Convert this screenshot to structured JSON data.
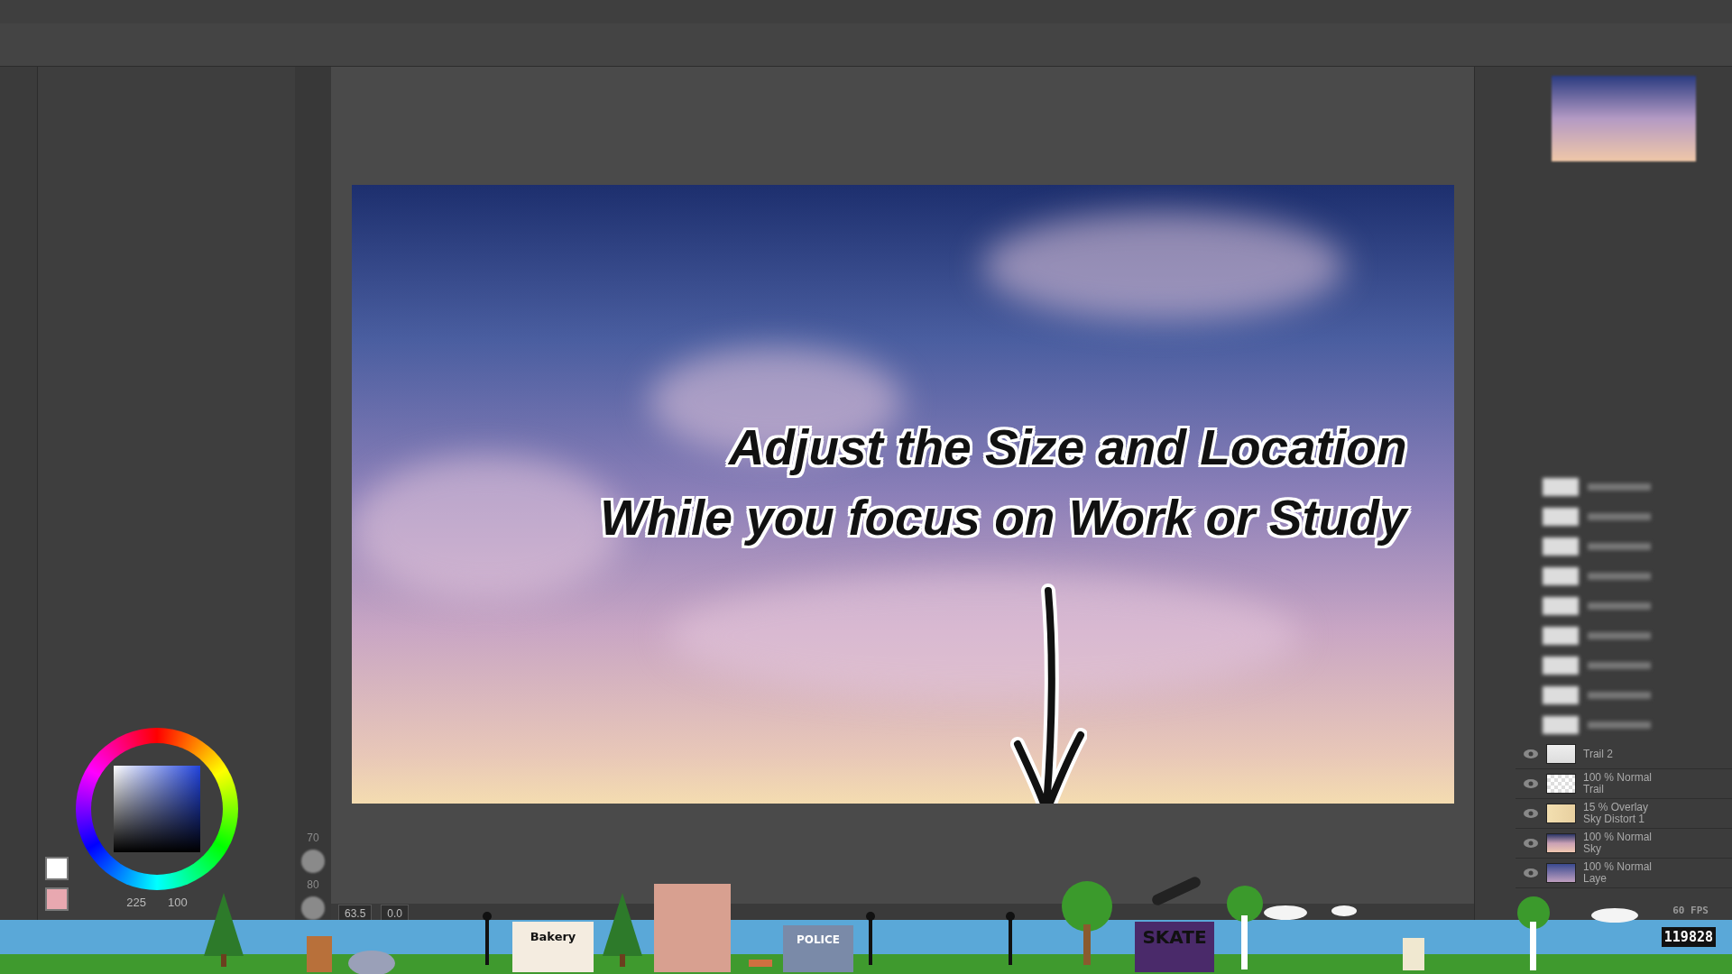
{
  "headline": [
    "Adjust the Size and Location",
    "While you focus on Work or Study"
  ],
  "color_panel": {
    "hue": "225",
    "value": "100"
  },
  "brush_sizes": [
    "70",
    "80"
  ],
  "canvas_nav": {
    "zoom": "63.5",
    "angle": "0.0"
  },
  "layers": [
    {
      "name": "Trail 2"
    },
    {
      "mode": "100 % Normal",
      "name": "Trail"
    },
    {
      "mode": "15 % Overlay",
      "name": "Sky Distort 1"
    },
    {
      "mode": "100 % Normal",
      "name": "Sky"
    },
    {
      "mode": "100 % Normal",
      "name": "Laye"
    }
  ],
  "game": {
    "fps": "60 FPS",
    "coins": "119828",
    "signs": [
      {
        "kind": "bakery",
        "text": "Bakery"
      },
      {
        "kind": "police",
        "text": "POLICE"
      },
      {
        "kind": "skate",
        "text": "SKATE"
      }
    ]
  }
}
